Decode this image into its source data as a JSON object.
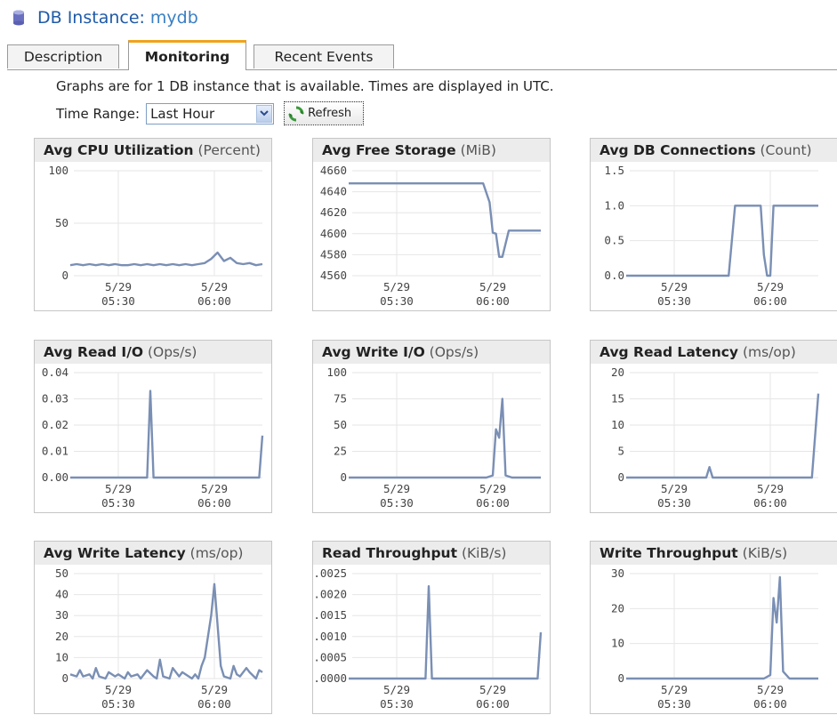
{
  "header": {
    "title_label": "DB Instance:",
    "instance_name": "mydb"
  },
  "tabs": [
    {
      "label": "Description",
      "active": false
    },
    {
      "label": "Monitoring",
      "active": true
    },
    {
      "label": "Recent Events",
      "active": false
    }
  ],
  "monitoring": {
    "info_text": "Graphs are for 1 DB instance that is available. Times are displayed in UTC.",
    "time_range_label": "Time Range:",
    "time_range_value": "Last Hour",
    "refresh_label": "Refresh"
  },
  "chart_data": [
    {
      "type": "line",
      "title": "Avg CPU Utilization",
      "unit": "(Percent)",
      "x_ticks": [
        "5/29\n05:30",
        "5/29\n06:00"
      ],
      "y_ticks": [
        "100",
        "50",
        "0"
      ],
      "ylim": [
        0,
        100
      ],
      "x": [
        0,
        2,
        4,
        6,
        8,
        10,
        12,
        14,
        16,
        18,
        20,
        22,
        24,
        26,
        28,
        30,
        32,
        34,
        36,
        38,
        40,
        42,
        44,
        46,
        48,
        50,
        52,
        54,
        56,
        58,
        60
      ],
      "series": [
        {
          "values": [
            10,
            11,
            10,
            11,
            10,
            11,
            10,
            11,
            10,
            10,
            11,
            10,
            11,
            10,
            11,
            10,
            11,
            10,
            11,
            10,
            11,
            12,
            16,
            22,
            14,
            17,
            12,
            11,
            12,
            10,
            11
          ]
        }
      ]
    },
    {
      "type": "line",
      "title": "Avg Free Storage",
      "unit": "(MiB)",
      "x_ticks": [
        "5/29\n05:30",
        "5/29\n06:00"
      ],
      "y_ticks": [
        "4660",
        "4640",
        "4620",
        "4600",
        "4580",
        "4560"
      ],
      "ylim": [
        4560,
        4660
      ],
      "x": [
        0,
        42,
        44,
        45,
        46,
        47,
        48,
        50,
        54,
        60
      ],
      "series": [
        {
          "values": [
            4648,
            4648,
            4630,
            4601,
            4600,
            4578,
            4578,
            4603,
            4603,
            4603
          ]
        }
      ]
    },
    {
      "type": "line",
      "title": "Avg DB Connections",
      "unit": "(Count)",
      "x_ticks": [
        "5/29\n05:30",
        "5/29\n06:00"
      ],
      "y_ticks": [
        "1.5",
        "1.0",
        "0.5",
        "0.0"
      ],
      "ylim": [
        0,
        1.5
      ],
      "x": [
        0,
        32,
        34,
        42,
        43,
        44,
        45,
        46,
        60
      ],
      "series": [
        {
          "values": [
            0,
            0,
            1,
            1,
            0.3,
            0,
            0,
            1,
            1
          ]
        }
      ]
    },
    {
      "type": "line",
      "title": "Avg Read I/O",
      "unit": "(Ops/s)",
      "x_ticks": [
        "5/29\n05:30",
        "5/29\n06:00"
      ],
      "y_ticks": [
        "0.04",
        "0.03",
        "0.02",
        "0.01",
        "0.00"
      ],
      "ylim": [
        0,
        0.04
      ],
      "x": [
        0,
        24,
        25,
        26,
        59,
        60
      ],
      "series": [
        {
          "values": [
            0,
            0,
            0.033,
            0,
            0,
            0.016
          ]
        }
      ]
    },
    {
      "type": "line",
      "title": "Avg Write I/O",
      "unit": "(Ops/s)",
      "x_ticks": [
        "5/29\n05:30",
        "5/29\n06:00"
      ],
      "y_ticks": [
        "100",
        "75",
        "50",
        "25",
        "0"
      ],
      "ylim": [
        0,
        100
      ],
      "x": [
        0,
        40,
        43,
        45,
        46,
        47,
        48,
        49,
        51,
        60
      ],
      "series": [
        {
          "values": [
            0,
            0,
            0,
            2,
            46,
            38,
            75,
            2,
            0,
            0
          ]
        }
      ]
    },
    {
      "type": "line",
      "title": "Avg Read Latency",
      "unit": "(ms/op)",
      "x_ticks": [
        "5/29\n05:30",
        "5/29\n06:00"
      ],
      "y_ticks": [
        "20",
        "15",
        "10",
        "5",
        "0"
      ],
      "ylim": [
        0,
        20
      ],
      "x": [
        0,
        25,
        26,
        27,
        58,
        60
      ],
      "series": [
        {
          "values": [
            0,
            0,
            2,
            0,
            0,
            16
          ]
        }
      ]
    },
    {
      "type": "line",
      "title": "Avg Write Latency",
      "unit": "(ms/op)",
      "x_ticks": [
        "5/29\n05:30",
        "5/29\n06:00"
      ],
      "y_ticks": [
        "50",
        "40",
        "30",
        "20",
        "10",
        "0"
      ],
      "ylim": [
        0,
        50
      ],
      "x": [
        0,
        2,
        3,
        4,
        6,
        7,
        8,
        9,
        11,
        12,
        14,
        15,
        17,
        18,
        19,
        21,
        22,
        24,
        26,
        27,
        28,
        29,
        31,
        32,
        34,
        35,
        37,
        38,
        39,
        40,
        41,
        42,
        44,
        45,
        47,
        48,
        50,
        51,
        52,
        53,
        55,
        56,
        58,
        59,
        60
      ],
      "series": [
        {
          "values": [
            2,
            1,
            4,
            1,
            2,
            0,
            5,
            1,
            0,
            3,
            1,
            2,
            0,
            3,
            1,
            2,
            0,
            4,
            1,
            0,
            9,
            1,
            0,
            5,
            1,
            3,
            1,
            0,
            2,
            0,
            6,
            10,
            30,
            45,
            6,
            1,
            0,
            6,
            2,
            1,
            5,
            3,
            0,
            4,
            3
          ]
        }
      ]
    },
    {
      "type": "line",
      "title": "Read Throughput",
      "unit": "(KiB/s)",
      "x_ticks": [
        "5/29\n05:30",
        "5/29\n06:00"
      ],
      "y_ticks": [
        "0.0025",
        "0.0020",
        "0.0015",
        "0.0010",
        "0.0005",
        "0.0000"
      ],
      "ylim": [
        0,
        0.0025
      ],
      "x": [
        0,
        24,
        25,
        26,
        59,
        60
      ],
      "series": [
        {
          "values": [
            0,
            0,
            0.0022,
            0,
            0,
            0.0011
          ]
        }
      ]
    },
    {
      "type": "line",
      "title": "Write Throughput",
      "unit": "(KiB/s)",
      "x_ticks": [
        "5/29\n05:30",
        "5/29\n06:00"
      ],
      "y_ticks": [
        "30",
        "20",
        "10",
        "0"
      ],
      "ylim": [
        0,
        30
      ],
      "x": [
        0,
        43,
        45,
        46,
        47,
        48,
        49,
        51,
        60
      ],
      "series": [
        {
          "values": [
            0,
            0,
            1,
            23,
            16,
            29,
            2,
            0,
            0
          ]
        }
      ]
    }
  ]
}
